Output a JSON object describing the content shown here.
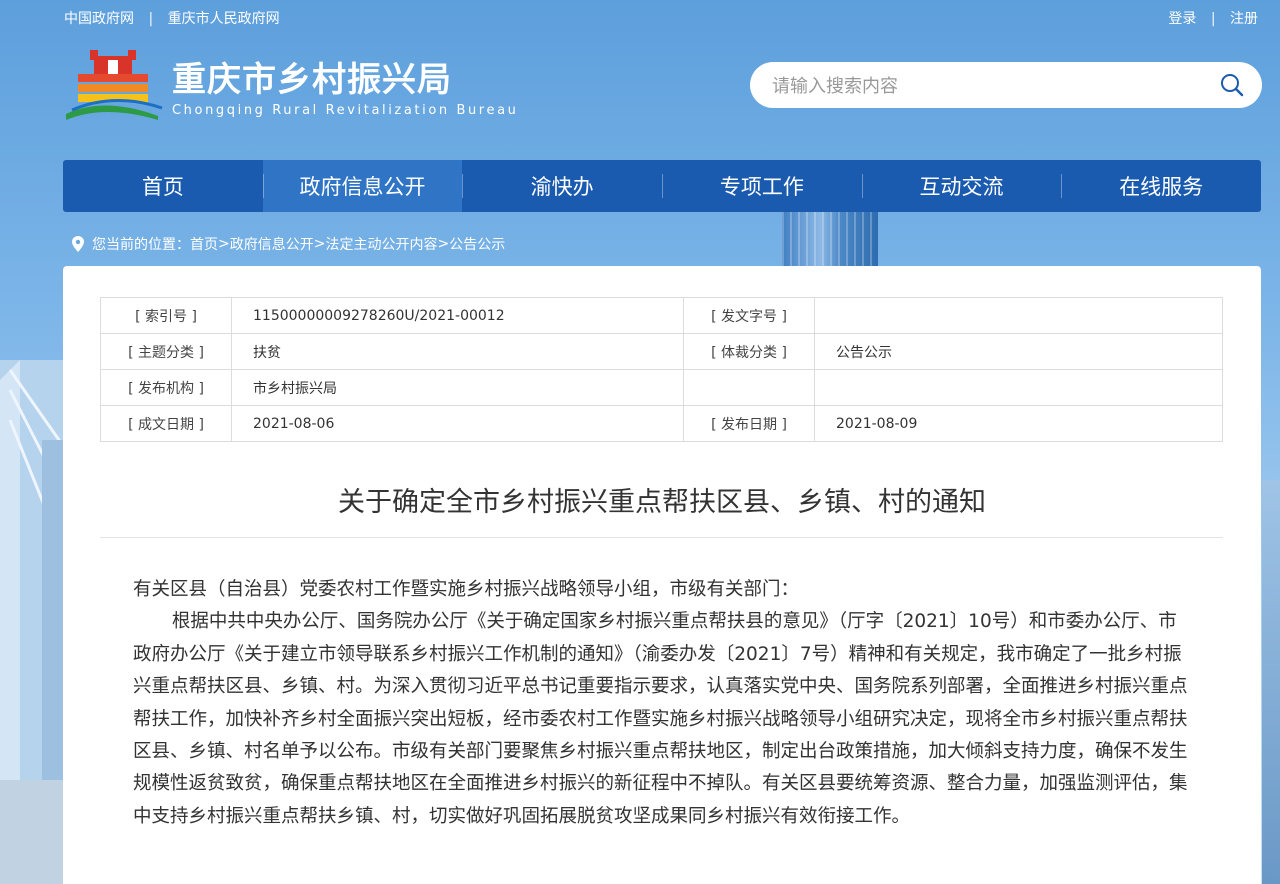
{
  "topbar": {
    "links_left": [
      "中国政府网",
      "重庆市人民政府网"
    ],
    "separator": "|",
    "links_right": [
      "登录",
      "注册"
    ]
  },
  "site": {
    "title": "重庆市乡村振兴局",
    "subtitle": "Chongqing Rural Revitalization Bureau"
  },
  "search": {
    "placeholder": "请输入搜索内容",
    "icon": "search-icon"
  },
  "nav": {
    "items": [
      "首页",
      "政府信息公开",
      "渝快办",
      "专项工作",
      "互动交流",
      "在线服务"
    ],
    "active_index": 1
  },
  "breadcrumb": {
    "prefix": "您当前的位置：",
    "items": [
      "首页",
      "政府信息公开",
      "法定主动公开内容",
      "公告公示"
    ],
    "separator": " >"
  },
  "meta": {
    "rows": [
      [
        "[ 索引号 ]",
        "11500000009278260U/2021-00012",
        "[ 发文字号 ]",
        ""
      ],
      [
        "[ 主题分类 ]",
        "扶贫",
        "[ 体裁分类 ]",
        "公告公示"
      ],
      [
        "[ 发布机构 ]",
        "市乡村振兴局",
        "",
        ""
      ],
      [
        "[ 成文日期 ]",
        "2021-08-06",
        "[ 发布日期 ]",
        "2021-08-09"
      ]
    ]
  },
  "document": {
    "title": "关于确定全市乡村振兴重点帮扶区县、乡镇、村的通知",
    "salutation": "有关区县（自治县）党委农村工作暨实施乡村振兴战略领导小组，市级有关部门：",
    "paragraph1": "根据中共中央办公厅、国务院办公厅《关于确定国家乡村振兴重点帮扶县的意见》（厅字〔2021〕10号）和市委办公厅、市政府办公厅《关于建立市领导联系乡村振兴工作机制的通知》（渝委办发〔2021〕7号）精神和有关规定，我市确定了一批乡村振兴重点帮扶区县、乡镇、村。为深入贯彻习近平总书记重要指示要求，认真落实党中央、国务院系列部署，全面推进乡村振兴重点帮扶工作，加快补齐乡村全面振兴突出短板，经市委农村工作暨实施乡村振兴战略领导小组研究决定，现将全市乡村振兴重点帮扶区县、乡镇、村名单予以公布。市级有关部门要聚焦乡村振兴重点帮扶地区，制定出台政策措施，加大倾斜支持力度，确保不发生规模性返贫致贫，确保重点帮扶地区在全面推进乡村振兴的新征程中不掉队。有关区县要统筹资源、整合力量，加强监测评估，集中支持乡村振兴重点帮扶乡镇、村，切实做好巩固拓展脱贫攻坚成果同乡村振兴有效衔接工作。"
  },
  "colors": {
    "nav_bg": "#1a5bb0",
    "nav_active": "#2f74c5",
    "text": "#333333"
  }
}
